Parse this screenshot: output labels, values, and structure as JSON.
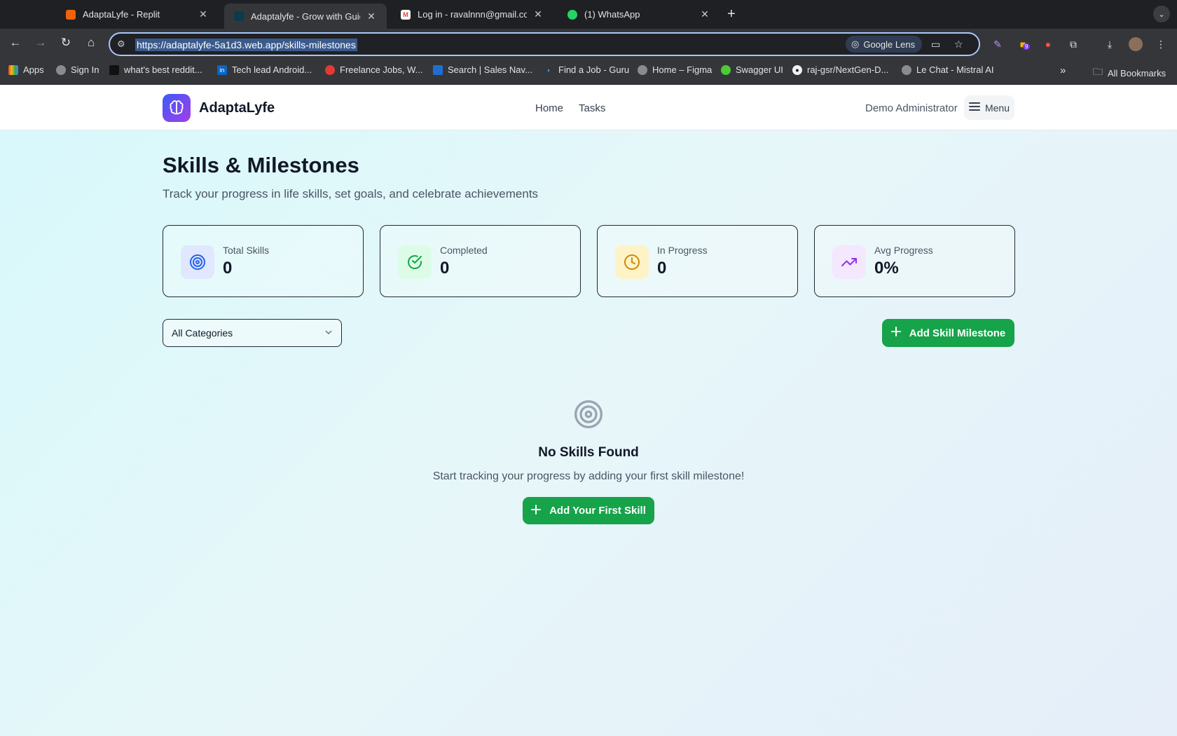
{
  "browser": {
    "tabs": [
      {
        "title": "AdaptaLyfe - Replit",
        "favicon_color": "#f26207",
        "active": false
      },
      {
        "title": "Adaptalyfe - Grow with Guida",
        "favicon_color": "#0b3b4a",
        "active": true
      },
      {
        "title": "Log in - ravalnnn@gmail.com",
        "favicon_color": "#ea4335",
        "active": false
      },
      {
        "title": "(1) WhatsApp",
        "favicon_color": "#25d366",
        "active": false
      }
    ],
    "url": "https://adaptalyfe-5a1d3.web.app/skills-milestones",
    "lens_label": "Google Lens",
    "extension_badge": "9",
    "bookmarks": [
      {
        "label": "Apps"
      },
      {
        "label": "Sign In"
      },
      {
        "label": "what's best reddit..."
      },
      {
        "label": "Tech lead Android..."
      },
      {
        "label": "Freelance Jobs, W..."
      },
      {
        "label": "Search | Sales Nav..."
      },
      {
        "label": "Find a Job - Guru"
      },
      {
        "label": "Home – Figma"
      },
      {
        "label": "Swagger UI"
      },
      {
        "label": "raj-gsr/NextGen-D..."
      },
      {
        "label": "Le Chat - Mistral AI"
      }
    ],
    "all_bookmarks": "All Bookmarks"
  },
  "app": {
    "brand": "AdaptaLyfe",
    "nav": {
      "home": "Home",
      "tasks": "Tasks"
    },
    "user": "Demo Administrator",
    "menu_label": "Menu"
  },
  "page": {
    "title": "Skills & Milestones",
    "subtitle": "Track your progress in life skills, set goals, and celebrate achievements",
    "stats": [
      {
        "label": "Total Skills",
        "value": "0",
        "icon": "target-icon",
        "bg": "#e0e7ff",
        "color": "#2563eb"
      },
      {
        "label": "Completed",
        "value": "0",
        "icon": "check-circle-icon",
        "bg": "#dcfce7",
        "color": "#16a34a"
      },
      {
        "label": "In Progress",
        "value": "0",
        "icon": "clock-icon",
        "bg": "#fef3c7",
        "color": "#ca8a04"
      },
      {
        "label": "Avg Progress",
        "value": "0%",
        "icon": "trending-up-icon",
        "bg": "#f3e8ff",
        "color": "#9333ea"
      }
    ],
    "category_filter": "All Categories",
    "add_button": "Add Skill Milestone",
    "empty": {
      "title": "No Skills Found",
      "message": "Start tracking your progress by adding your first skill milestone!",
      "button": "Add Your First Skill"
    }
  },
  "colors": {
    "accent_green": "#16a34a",
    "brand_gradient_start": "#3b5bf6",
    "brand_gradient_end": "#a43ee8"
  }
}
